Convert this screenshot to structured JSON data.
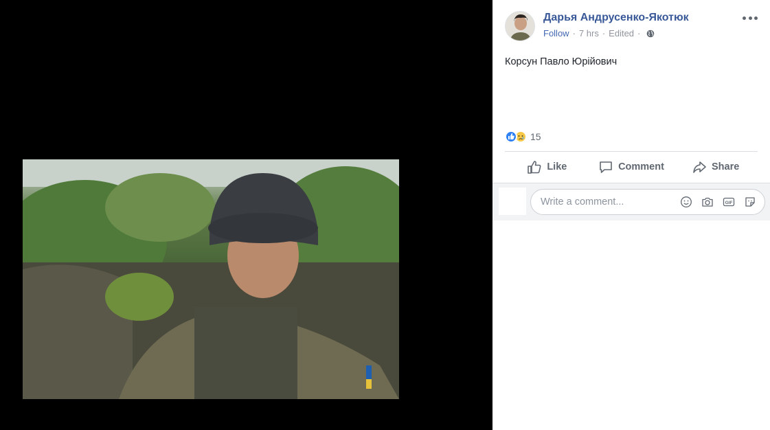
{
  "post": {
    "author": "Дарья Андрусенко-Якотюк",
    "follow_label": "Follow",
    "separator": "·",
    "time": "7 hrs",
    "edited_label": "Edited",
    "text": "Корсун Павло Юрійович",
    "reaction_count": "15"
  },
  "actions": {
    "like_label": "Like",
    "comment_label": "Comment",
    "share_label": "Share"
  },
  "comment": {
    "placeholder": "Write a comment..."
  },
  "icons": {
    "more": "more-options-icon",
    "globe": "globe-icon",
    "like": "thumbs-up-icon",
    "comment": "speech-bubble-icon",
    "share": "share-arrow-icon",
    "emoji": "smiley-icon",
    "camera": "camera-icon",
    "gif": "gif-icon",
    "sticker": "sticker-icon"
  },
  "colors": {
    "link_blue": "#385898",
    "follow_blue": "#4267b2",
    "meta_gray": "#90949c",
    "like_blue": "#2e81f4",
    "sad_yellow": "#f7c948"
  }
}
